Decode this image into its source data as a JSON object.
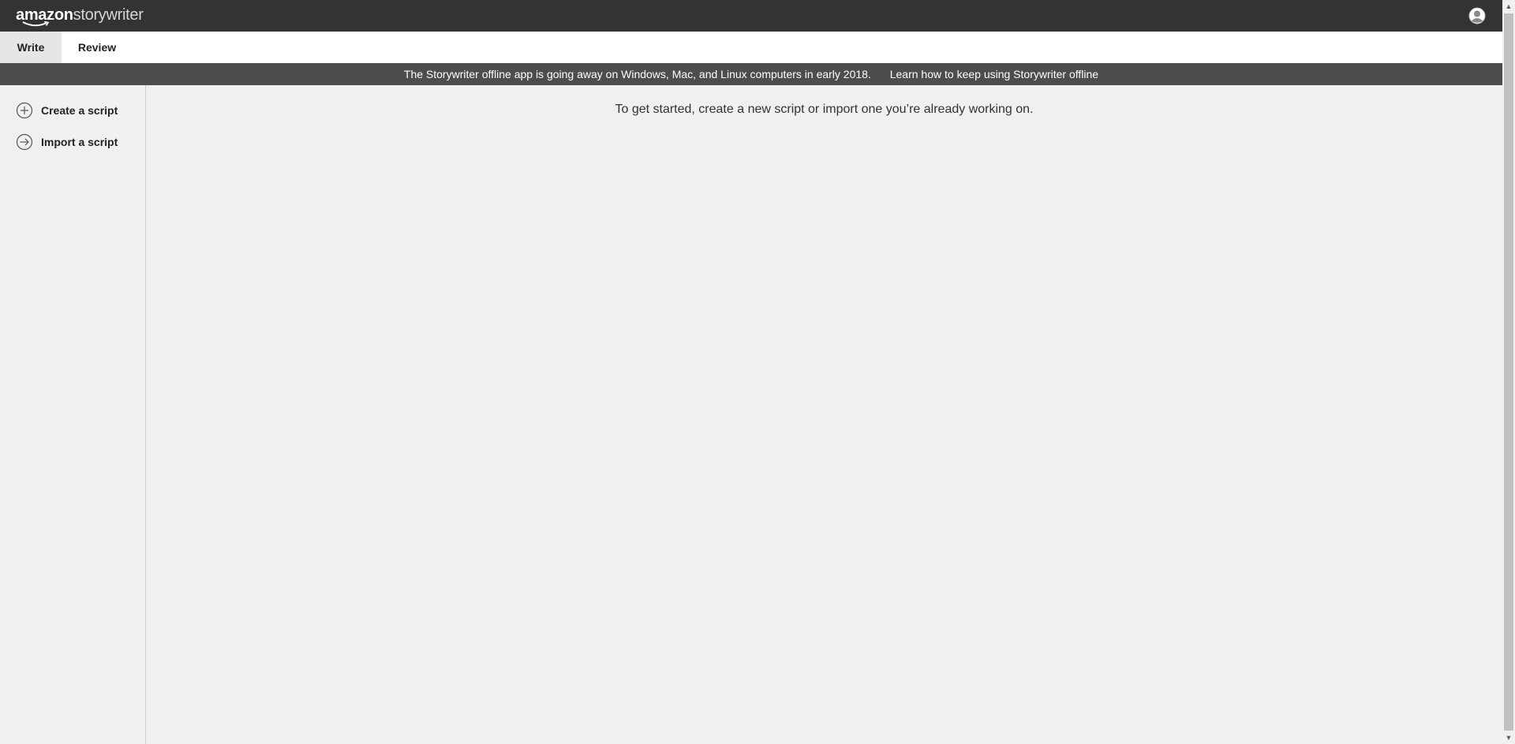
{
  "header": {
    "logo_brand": "amazon",
    "logo_product": "storywriter",
    "user_icon": "user-avatar-icon"
  },
  "tabs": [
    {
      "label": "Write",
      "active": true
    },
    {
      "label": "Review",
      "active": false
    }
  ],
  "banner": {
    "message": "The Storywriter offline app is going away on Windows, Mac, and Linux computers in early 2018.",
    "link_text": "Learn how to keep using Storywriter offline"
  },
  "sidebar": {
    "items": [
      {
        "label": "Create a script",
        "icon": "plus-circle-icon"
      },
      {
        "label": "Import a script",
        "icon": "arrow-circle-icon"
      }
    ]
  },
  "main": {
    "empty_message": "To get started, create a new script or import one you’re already working on."
  },
  "colors": {
    "topbar": "#333333",
    "banner": "#4d4d4d",
    "background": "#f0f0f0",
    "active_tab": "#e6e6e6"
  }
}
